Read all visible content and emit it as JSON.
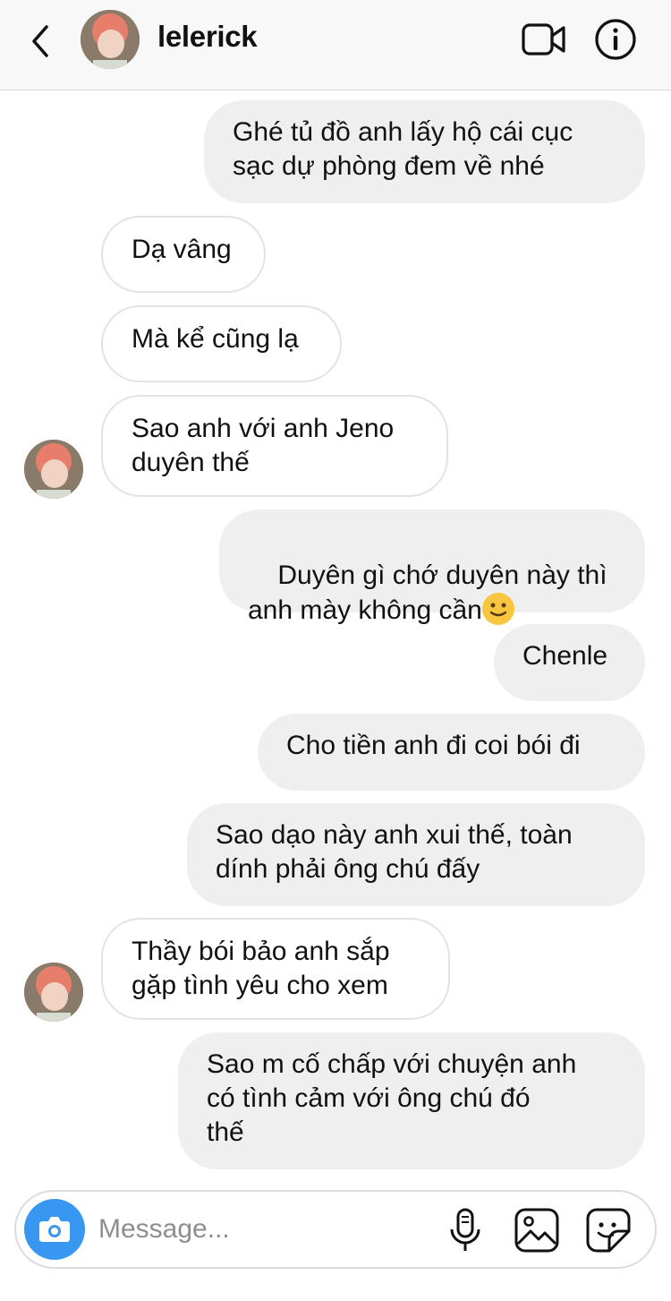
{
  "header": {
    "username": "lelerick",
    "back_icon": "chevron-left-icon",
    "video_icon": "video-camera-icon",
    "info_icon": "info-icon"
  },
  "messages": [
    {
      "side": "sent",
      "text": "Ghé tủ đồ anh lấy hộ cái cục\nsạc dự phòng đem về nhé"
    },
    {
      "side": "received",
      "text": "Dạ vâng"
    },
    {
      "side": "received",
      "text": "Mà kể cũng lạ"
    },
    {
      "side": "received",
      "text": "Sao anh với anh Jeno\nduyên thế"
    },
    {
      "side": "sent",
      "text": "Duyên gì chớ duyên này thì\nanh mày không cần",
      "emoji": "slightly-smiling-face-emoji"
    },
    {
      "side": "sent",
      "text": "Chenle"
    },
    {
      "side": "sent",
      "text": "Cho tiền anh đi coi bói đi"
    },
    {
      "side": "sent",
      "text": "Sao dạo này anh xui thế, toàn\ndính phải ông chú đấy"
    },
    {
      "side": "received",
      "text": "Thầy bói bảo anh sắp\ngặp tình yêu cho xem"
    },
    {
      "side": "sent",
      "text": "Sao m cố chấp với chuyện anh\ncó tình cảm với ông chú đó\nthế"
    }
  ],
  "composer": {
    "placeholder": "Message...",
    "camera_icon": "camera-icon",
    "mic_icon": "microphone-icon",
    "gallery_icon": "image-gallery-icon",
    "sticker_icon": "sticker-icon"
  },
  "colors": {
    "accent": "#3897f0",
    "sent_bubble": "#efefef",
    "received_border": "#e3e3e3",
    "header_bg": "#f8f8f8"
  }
}
